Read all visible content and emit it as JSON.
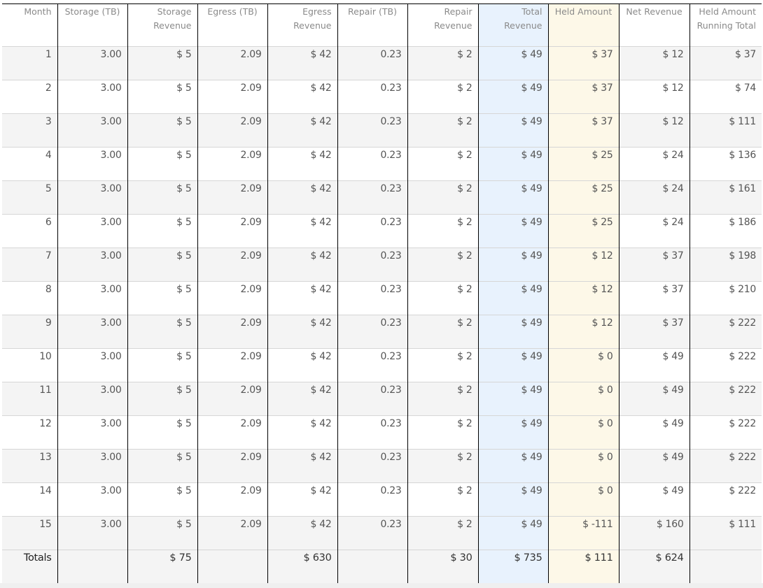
{
  "table": {
    "columns": [
      "Month",
      "Storage (TB)",
      "Storage Revenue",
      "Egress (TB)",
      "Egress Revenue",
      "Repair (TB)",
      "Repair Revenue",
      "Total Revenue",
      "Held Amount",
      "Net Revenue",
      "Held Amount Running Total"
    ],
    "highlight_colors": {
      "total_revenue": "#e8f2fd",
      "held_amount": "#fdf8e8"
    },
    "rows": [
      [
        "1",
        "3.00",
        "$ 5",
        "2.09",
        "$ 42",
        "0.23",
        "$ 2",
        "$ 49",
        "$ 37",
        "$ 12",
        "$ 37"
      ],
      [
        "2",
        "3.00",
        "$ 5",
        "2.09",
        "$ 42",
        "0.23",
        "$ 2",
        "$ 49",
        "$ 37",
        "$ 12",
        "$ 74"
      ],
      [
        "3",
        "3.00",
        "$ 5",
        "2.09",
        "$ 42",
        "0.23",
        "$ 2",
        "$ 49",
        "$ 37",
        "$ 12",
        "$ 111"
      ],
      [
        "4",
        "3.00",
        "$ 5",
        "2.09",
        "$ 42",
        "0.23",
        "$ 2",
        "$ 49",
        "$ 25",
        "$ 24",
        "$ 136"
      ],
      [
        "5",
        "3.00",
        "$ 5",
        "2.09",
        "$ 42",
        "0.23",
        "$ 2",
        "$ 49",
        "$ 25",
        "$ 24",
        "$ 161"
      ],
      [
        "6",
        "3.00",
        "$ 5",
        "2.09",
        "$ 42",
        "0.23",
        "$ 2",
        "$ 49",
        "$ 25",
        "$ 24",
        "$ 186"
      ],
      [
        "7",
        "3.00",
        "$ 5",
        "2.09",
        "$ 42",
        "0.23",
        "$ 2",
        "$ 49",
        "$ 12",
        "$ 37",
        "$ 198"
      ],
      [
        "8",
        "3.00",
        "$ 5",
        "2.09",
        "$ 42",
        "0.23",
        "$ 2",
        "$ 49",
        "$ 12",
        "$ 37",
        "$ 210"
      ],
      [
        "9",
        "3.00",
        "$ 5",
        "2.09",
        "$ 42",
        "0.23",
        "$ 2",
        "$ 49",
        "$ 12",
        "$ 37",
        "$ 222"
      ],
      [
        "10",
        "3.00",
        "$ 5",
        "2.09",
        "$ 42",
        "0.23",
        "$ 2",
        "$ 49",
        "$ 0",
        "$ 49",
        "$ 222"
      ],
      [
        "11",
        "3.00",
        "$ 5",
        "2.09",
        "$ 42",
        "0.23",
        "$ 2",
        "$ 49",
        "$ 0",
        "$ 49",
        "$ 222"
      ],
      [
        "12",
        "3.00",
        "$ 5",
        "2.09",
        "$ 42",
        "0.23",
        "$ 2",
        "$ 49",
        "$ 0",
        "$ 49",
        "$ 222"
      ],
      [
        "13",
        "3.00",
        "$ 5",
        "2.09",
        "$ 42",
        "0.23",
        "$ 2",
        "$ 49",
        "$ 0",
        "$ 49",
        "$ 222"
      ],
      [
        "14",
        "3.00",
        "$ 5",
        "2.09",
        "$ 42",
        "0.23",
        "$ 2",
        "$ 49",
        "$ 0",
        "$ 49",
        "$ 222"
      ],
      [
        "15",
        "3.00",
        "$ 5",
        "2.09",
        "$ 42",
        "0.23",
        "$ 2",
        "$ 49",
        "$ -111",
        "$ 160",
        "$ 111"
      ]
    ],
    "totals": [
      "Totals",
      "",
      "$ 75",
      "",
      "$ 630",
      "",
      "$ 30",
      "$ 735",
      "$ 111",
      "$ 624",
      ""
    ]
  }
}
